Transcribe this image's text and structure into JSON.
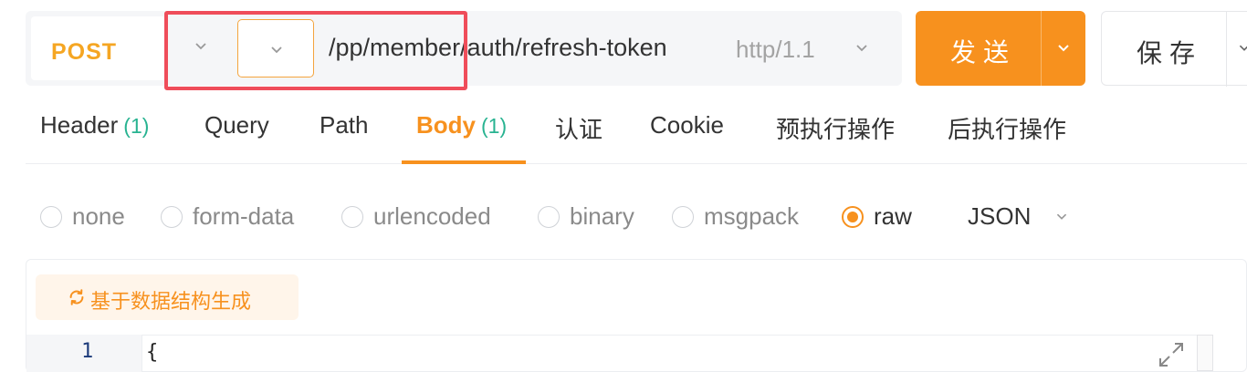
{
  "request": {
    "method": "POST",
    "url": "/pp/member/auth/refresh-token",
    "protocol": "http/1.1"
  },
  "actions": {
    "send_label": "发送",
    "save_label": "保存"
  },
  "tabs": [
    {
      "label": "Header",
      "count": "(1)"
    },
    {
      "label": "Query",
      "count": ""
    },
    {
      "label": "Path",
      "count": ""
    },
    {
      "label": "Body",
      "count": "(1)"
    },
    {
      "label": "认证",
      "count": ""
    },
    {
      "label": "Cookie",
      "count": ""
    },
    {
      "label": "预执行操作",
      "count": ""
    },
    {
      "label": "后执行操作",
      "count": ""
    }
  ],
  "active_tab": "Body",
  "body_types": [
    {
      "label": "none",
      "checked": false
    },
    {
      "label": "form-data",
      "checked": false
    },
    {
      "label": "urlencoded",
      "checked": false
    },
    {
      "label": "binary",
      "checked": false
    },
    {
      "label": "msgpack",
      "checked": false
    },
    {
      "label": "raw",
      "checked": true
    }
  ],
  "raw_format": "JSON",
  "editor": {
    "generate_label": "基于数据结构生成",
    "lines": [
      {
        "number": "1",
        "text": "{"
      }
    ]
  },
  "icons": {
    "env": "chevron-down-icon",
    "prefix": "chevron-down-icon",
    "generate": "refresh-icon",
    "expand": "expand-icon"
  },
  "colors": {
    "accent": "#f7911e",
    "method": "#f5a623",
    "count": "#28b391",
    "highlight": "#ef4d5a"
  }
}
